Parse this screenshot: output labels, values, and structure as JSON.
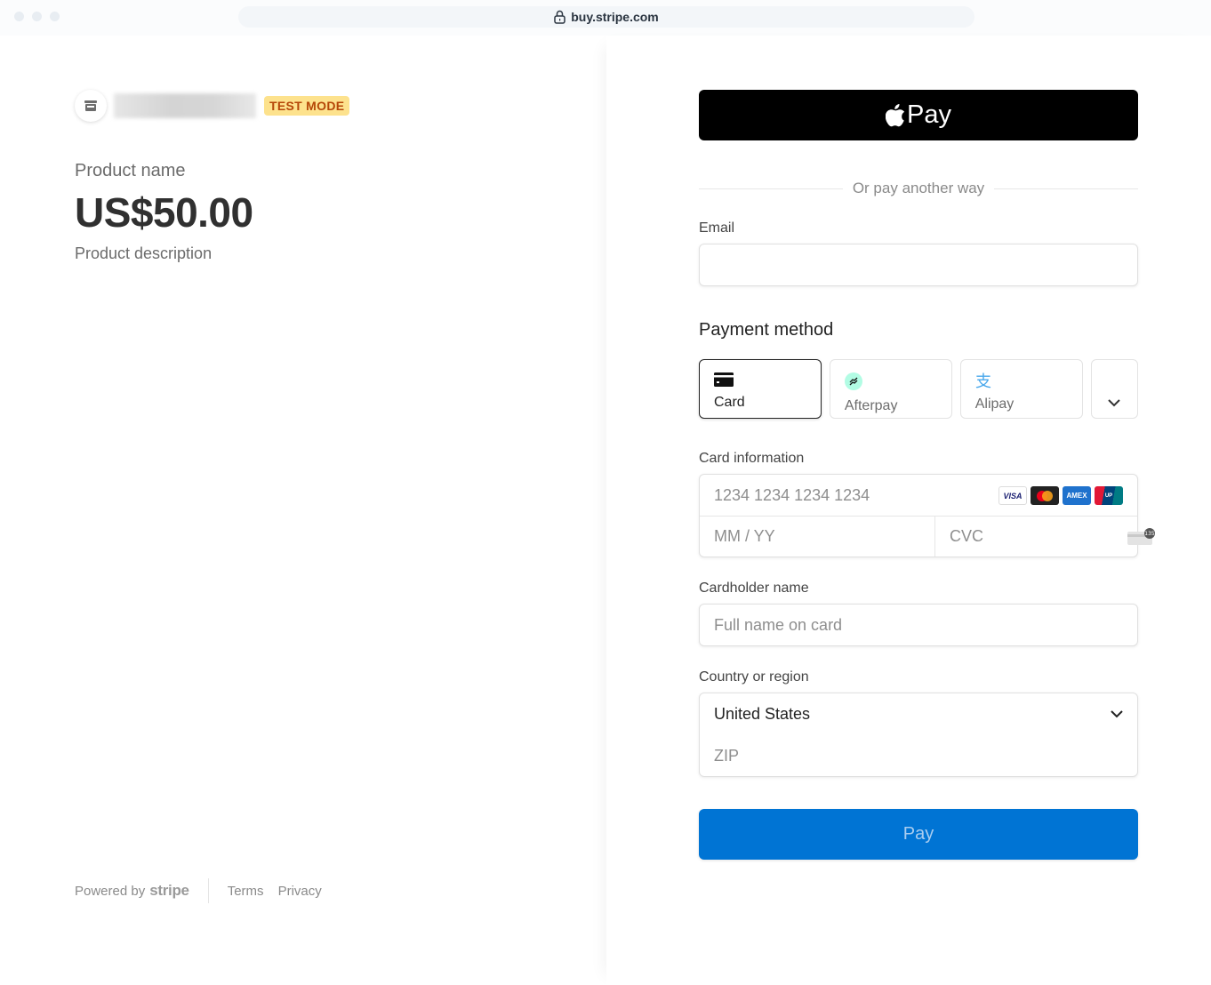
{
  "browser": {
    "url": "buy.stripe.com",
    "lock_icon": "lock-icon"
  },
  "merchant": {
    "logo_icon": "store-icon",
    "name_blurred": "",
    "badge": "TEST MODE"
  },
  "product": {
    "name": "Product name",
    "price": "US$50.00",
    "description": "Product description"
  },
  "footer": {
    "powered_by": "Powered by",
    "brand": "stripe",
    "links": [
      "Terms",
      "Privacy"
    ]
  },
  "form": {
    "apple_pay_label": "Pay",
    "divider_text": "Or pay another way",
    "email_label": "Email",
    "email_value": "",
    "payment_method_title": "Payment method",
    "methods": [
      {
        "label": "Card",
        "icon": "card-icon",
        "selected": true
      },
      {
        "label": "Afterpay",
        "icon": "afterpay-icon",
        "selected": false
      },
      {
        "label": "Alipay",
        "icon": "alipay-icon",
        "selected": false
      }
    ],
    "more_methods_icon": "chevron-down-icon",
    "card_info_label": "Card information",
    "card_number_placeholder": "1234 1234 1234 1234",
    "card_brands": [
      "VISA",
      "Mastercard",
      "AMEX",
      "UnionPay"
    ],
    "expiry_placeholder": "MM / YY",
    "cvc_placeholder": "CVC",
    "cvc_hint": "135",
    "cardholder_label": "Cardholder name",
    "cardholder_placeholder": "Full name on card",
    "country_label": "Country or region",
    "country_value": "United States",
    "zip_placeholder": "ZIP",
    "pay_button": "Pay"
  },
  "colors": {
    "pay_button": "#0074d4",
    "test_badge_bg": "#fde28d",
    "test_badge_text": "#b54708"
  }
}
